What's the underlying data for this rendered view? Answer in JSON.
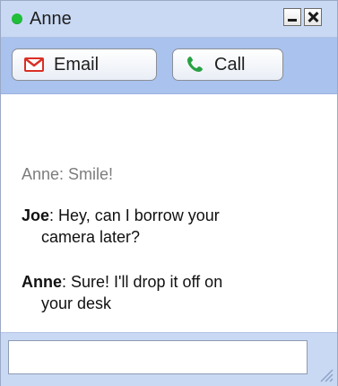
{
  "window": {
    "contact_name": "Anne",
    "status_color": "#1fbf3a"
  },
  "toolbar": {
    "email_label": "Email",
    "call_label": "Call",
    "email_icon": "gmail-icon",
    "call_icon": "phone-icon"
  },
  "chat": {
    "messages": [
      {
        "sender": "",
        "text": "Anne: Smile!",
        "type": "system"
      },
      {
        "sender": "Joe",
        "text": ": Hey, can I borrow your",
        "continuation": "camera later?"
      },
      {
        "sender": "Anne",
        "text": ": Sure!  I'll drop it off on",
        "continuation": "your desk"
      }
    ]
  },
  "input": {
    "value": "",
    "placeholder": ""
  }
}
